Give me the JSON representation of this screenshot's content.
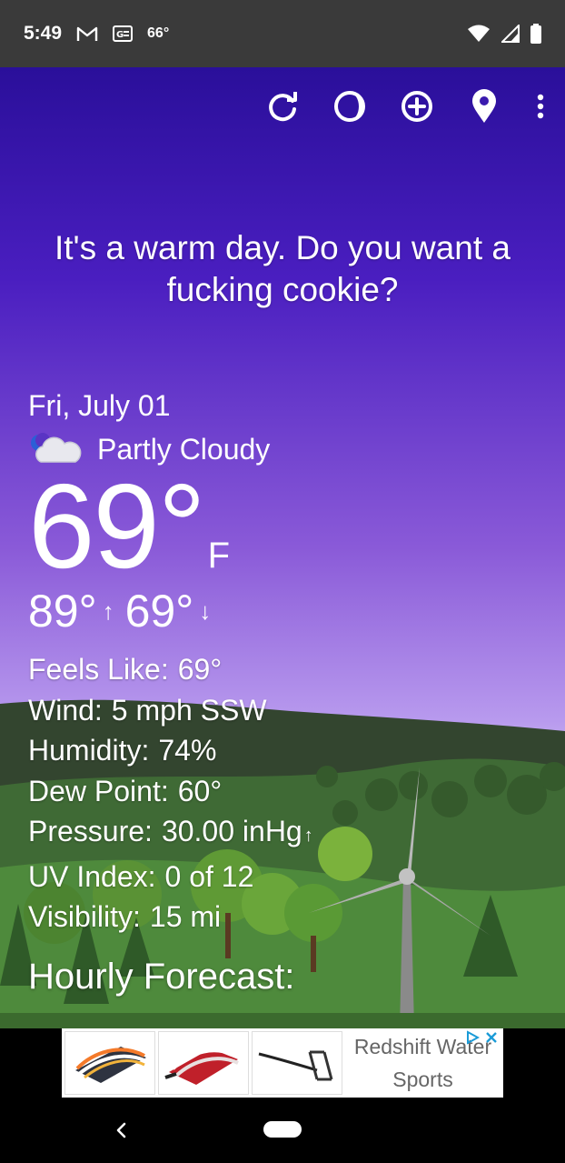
{
  "status_bar": {
    "time": "5:49",
    "temperature": "66°",
    "icons": [
      "gmail-icon",
      "news-icon",
      "wifi-icon",
      "cell-signal-icon",
      "battery-icon"
    ]
  },
  "toolbar": {
    "icons": [
      "refresh-icon",
      "theme-icon",
      "add-location-icon",
      "location-pin-icon",
      "more-vert-icon"
    ]
  },
  "quip": "It's a warm day. Do you want a fucking cookie?",
  "current": {
    "date": "Fri, July 01",
    "condition": "Partly Cloudy",
    "condition_icon": "partly-cloudy-night-icon",
    "temperature": "69°",
    "unit": "F",
    "high": "89°",
    "low": "69°",
    "high_arrow": "↑",
    "low_arrow": "↓"
  },
  "details": {
    "feels_like_label": "Feels Like:",
    "feels_like": "69°",
    "wind_label": "Wind:",
    "wind": "5 mph SSW",
    "humidity_label": "Humidity:",
    "humidity": "74%",
    "dew_point_label": "Dew Point:",
    "dew_point": "60°",
    "pressure_label": "Pressure:",
    "pressure": "30.00 inHg",
    "pressure_trend": "↑",
    "uv_label": "UV Index:",
    "uv": "0 of 12",
    "visibility_label": "Visibility:",
    "visibility": "15 mi"
  },
  "hourly_title": "Hourly Forecast:",
  "ad": {
    "line1": "Redshift Water",
    "line2": "Sports"
  },
  "colors": {
    "sky_top": "#2a0f9a",
    "sky_bottom": "#c7b3f0",
    "hill_dark": "#2f4a2e",
    "grass": "#4e8a3c",
    "status_bar": "#3a3a3a"
  }
}
